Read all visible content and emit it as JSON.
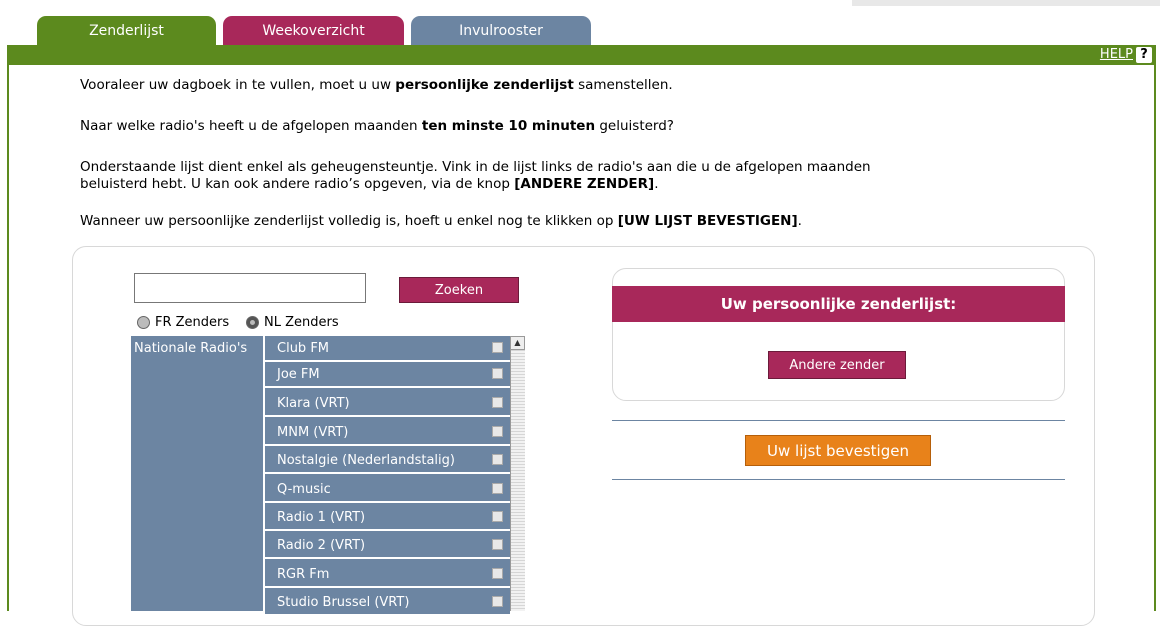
{
  "tabs": [
    {
      "label": "Zenderlijst"
    },
    {
      "label": "Weekoverzicht"
    },
    {
      "label": "Invulrooster"
    }
  ],
  "help": {
    "label": "HELP",
    "icon_text": "?"
  },
  "intro": {
    "p1_a": "Vooraleer uw dagboek in te vullen, moet u uw ",
    "p1_b": "persoonlijke zenderlijst",
    "p1_c": " samenstellen.",
    "p2_a": "Naar welke radio's heeft u de afgelopen maanden ",
    "p2_b": "ten minste 10 minuten",
    "p2_c": " geluisterd?",
    "p3_line1": "Onderstaande lijst dient enkel als geheugensteuntje. Vink in de lijst links de radio's aan die u de afgelopen maanden",
    "p3_line2_a": "beluisterd hebt. U kan ook andere radio’s opgeven, via de knop ",
    "p3_line2_b": "[ANDERE ZENDER]",
    "p3_line2_c": ".",
    "p4_a": "Wanneer uw persoonlijke zenderlijst volledig is, hoeft u enkel nog te klikken op ",
    "p4_b": "[UW LIJST BEVESTIGEN]",
    "p4_c": "."
  },
  "search": {
    "value": "",
    "button_label": "Zoeken"
  },
  "language": {
    "options": [
      "FR Zenders",
      "NL Zenders"
    ],
    "selected": "NL Zenders"
  },
  "station_list": {
    "category": "Nationale Radio's",
    "stations": [
      "Club FM",
      "Joe FM",
      "Klara (VRT)",
      "MNM (VRT)",
      "Nostalgie (Nederlandstalig)",
      "Q-music",
      "Radio 1 (VRT)",
      "Radio 2 (VRT)",
      "RGR Fm",
      "Studio Brussel (VRT)"
    ]
  },
  "personal_list": {
    "title": "Uw persoonlijke zenderlijst:",
    "other_button": "Andere zender",
    "confirm_button": "Uw lijst bevestigen"
  },
  "colors": {
    "green": "#5c8a1e",
    "maroon": "#a8285a",
    "slate_blue": "#6c85a2",
    "orange": "#e8821a"
  }
}
